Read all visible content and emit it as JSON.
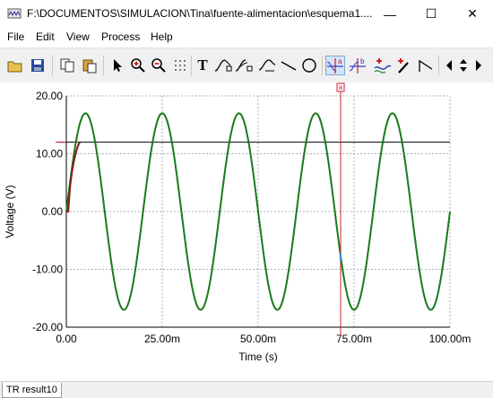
{
  "window": {
    "title": "F:\\DOCUMENTOS\\SIMULACION\\Tina\\fuente-alimentacion\\esquema1....",
    "min_glyph": "—",
    "max_glyph": "☐",
    "close_glyph": "✕"
  },
  "menu": {
    "items": [
      "File",
      "Edit",
      "View",
      "Process",
      "Help"
    ]
  },
  "toolbar": {
    "icons": [
      "open-icon",
      "save-icon",
      "copy-icon",
      "paste-icon",
      "pointer-icon",
      "zoom-in-icon",
      "zoom-out-icon",
      "grid-icon",
      "text-tool-icon",
      "curve-label-icon",
      "curve-label2-icon",
      "formula-label-icon",
      "line-tool-icon",
      "ellipse-tool-icon",
      "cursor-a-icon",
      "cursor-b-icon",
      "add-curve-icon",
      "probe-icon",
      "slope-icon",
      "arrow-left-icon",
      "arrow-updown-icon",
      "arrow-right-icon"
    ],
    "text_tool_glyph": "T"
  },
  "status": {
    "tab_label": "TR result10"
  },
  "cursor": {
    "label": "a",
    "time": 71.5
  },
  "colors": {
    "series": "#1a7a1a",
    "initial": "#8b1a1a",
    "reference": "#000000",
    "cursor": "#cc2233",
    "grid": "#b0b0b0"
  },
  "chart_data": {
    "type": "line",
    "xlabel": "Time (s)",
    "ylabel": "Voltage (V)",
    "xlim": [
      0,
      100
    ],
    "ylim": [
      -20,
      20
    ],
    "x_unit": "ms",
    "x_ticks": [
      0,
      25,
      50,
      75,
      100
    ],
    "x_tick_labels": [
      "0.00",
      "25.00m",
      "50.00m",
      "75.00m",
      "100.00m"
    ],
    "y_ticks": [
      -20,
      -10,
      0,
      10,
      20
    ],
    "y_tick_labels": [
      "-20.00",
      "-10.00",
      "0.00",
      "10.00",
      "20.00"
    ],
    "grid": true,
    "series": [
      {
        "kind": "sine",
        "amplitude": 17,
        "frequency_hz": 50,
        "offset": 0
      },
      {
        "kind": "segment",
        "x": [
          0,
          0.5,
          1.0,
          1.5,
          2.0,
          2.5,
          3.0,
          3.5
        ],
        "y": [
          0,
          0,
          4.5,
          7,
          8.8,
          10.2,
          11.3,
          12
        ]
      },
      {
        "kind": "hline",
        "y": 12
      }
    ]
  }
}
